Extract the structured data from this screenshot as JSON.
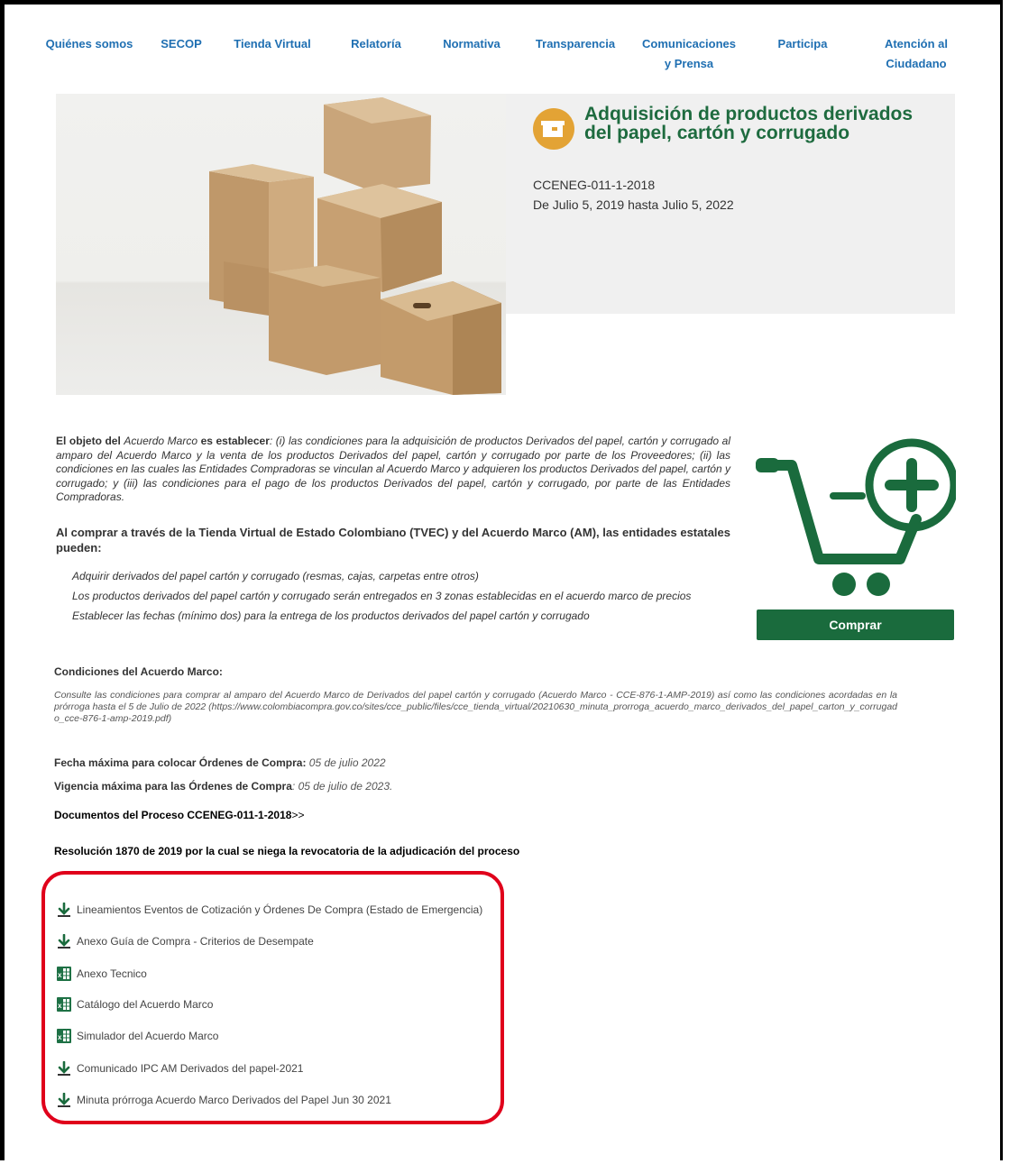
{
  "nav": [
    {
      "label": "Quiénes somos"
    },
    {
      "label": "SECOP"
    },
    {
      "label": "Tienda Virtual"
    },
    {
      "label": "Relatoría"
    },
    {
      "label": "Normativa"
    },
    {
      "label": "Transparencia"
    },
    {
      "label": "Comunicaciones y Prensa"
    },
    {
      "label": "Participa"
    },
    {
      "label": "Atención al Ciudadano"
    }
  ],
  "hero": {
    "title": "Adquisición de productos derivados del papel, cartón y corrugado",
    "code": "CCENEG-011-1-2018",
    "dates": "De Julio 5, 2019 hasta Julio 5, 2022",
    "icon": "box-icon"
  },
  "description": {
    "intro_bold_1": "El objeto del ",
    "intro_italic": "Acuerdo Marco",
    "intro_bold_2": " es establecer",
    "body": ": (i) las condiciones para la adquisición de productos Derivados del papel, cartón y corrugado al amparo del Acuerdo Marco y la venta de los productos Derivados del papel, cartón y corrugado por parte de los Proveedores; (ii) las condiciones en las cuales las Entidades Compradoras se vinculan al Acuerdo Marco y adquieren los productos Derivados del papel, cartón y corrugado; y (iii) las condiciones para el pago de los productos Derivados del papel, cartón y corrugado, por parte de las Entidades Compradoras.",
    "lead": "Al comprar a través de la Tienda Virtual de Estado Colombiano (TVEC) y del Acuerdo Marco (AM), las entidades estatales pueden:",
    "bullets": [
      "Adquirir derivados del papel cartón y corrugado (resmas, cajas, carpetas entre otros)",
      "Los productos derivados del papel cartón y corrugado serán entregados en 3 zonas establecidas en el acuerdo marco de precios",
      "Establecer las fechas (mínimo dos) para la entrega de los productos derivados del papel cartón y corrugado"
    ]
  },
  "buy_button": "Comprar",
  "conditions": {
    "title": "Condiciones del Acuerdo Marco:",
    "body": "Consulte las condiciones para comprar al amparo del Acuerdo Marco de Derivados del papel cartón y corrugado (Acuerdo Marco - CCE-876-1-AMP-2019) así como las condiciones acordadas en la prórroga hasta el 5 de Julio de 2022",
    "url": "(https://www.colombiacompra.gov.co/sites/cce_public/files/cce_tienda_virtual/20210630_minuta_prorroga_acuerdo_marco_derivados_del_papel_carton_y_corrugado_cce-876-1-amp-2019.pdf)",
    "max_date_label": "Fecha máxima para colocar Órdenes de Compra:",
    "max_date_value": "05 de julio 2022",
    "validity_label": "Vigencia máxima para las Órdenes de Compra",
    "validity_value": ": 05 de julio de 2023.",
    "docs_link": "Documentos del Proceso CCENEG-011-1-2018",
    "docs_link_suffix": ">>",
    "resolution": "Resolución 1870 de 2019 por la cual se niega la revocatoria de la adjudicación del proceso"
  },
  "downloads": [
    {
      "label": "Lineamientos Eventos de Cotización y Órdenes De Compra (Estado de Emergencia)",
      "icon": "download-arrow-icon"
    },
    {
      "label": "Anexo Guía de Compra - Criterios de Desempate",
      "icon": "download-arrow-icon"
    },
    {
      "label": "Anexo Tecnico",
      "icon": "excel-file-icon"
    },
    {
      "label": "Catálogo del Acuerdo Marco",
      "icon": "excel-file-icon"
    },
    {
      "label": "Simulador del Acuerdo Marco",
      "icon": "excel-file-icon"
    },
    {
      "label": "Comunicado IPC AM Derivados del papel-2021",
      "icon": "download-arrow-icon"
    },
    {
      "label": "Minuta prórroga Acuerdo Marco Derivados del Papel Jun 30 2021",
      "icon": "download-arrow-icon"
    }
  ],
  "colors": {
    "nav_link": "#1f6fb2",
    "brand_green": "#1a6b3d",
    "highlight_red": "#e0001b",
    "icon_orange": "#e3a335"
  }
}
